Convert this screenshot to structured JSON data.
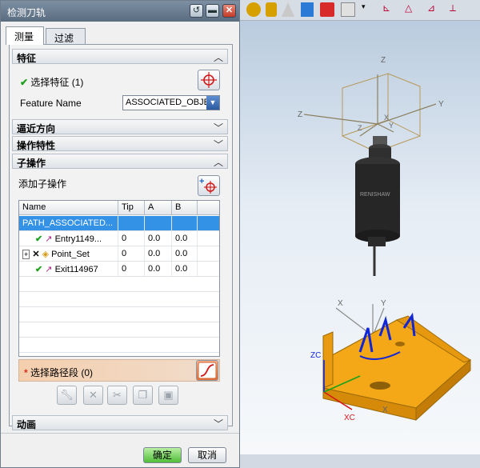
{
  "dialog": {
    "title": "检测刀轨",
    "tabs": [
      "测量",
      "过滤"
    ],
    "sections": {
      "feature": "特征",
      "approach": "逼近方向",
      "op_props": "操作特性",
      "sub_ops": "子操作",
      "animation": "动画"
    },
    "feature": {
      "select_label": "选择特征 (1)",
      "name_label": "Feature Name",
      "name_value": "ASSOCIATED_OBJE"
    },
    "sub_ops": {
      "add_label": "添加子操作",
      "columns": [
        "Name",
        "Tip",
        "A",
        "B"
      ],
      "rows": [
        {
          "name": "PATH_ASSOCIATED...",
          "tip": "",
          "a": "",
          "b": ""
        },
        {
          "name": "Entry1149...",
          "tip": "0",
          "a": "0.0",
          "b": "0.0"
        },
        {
          "name": "Point_Set",
          "tip": "0",
          "a": "0.0",
          "b": "0.0"
        },
        {
          "name": "Exit114967",
          "tip": "0",
          "a": "0.0",
          "b": "0.0"
        }
      ],
      "select_path_label": "选择路径段 (0)"
    },
    "buttons": {
      "ok": "确定",
      "cancel": "取消"
    }
  },
  "viewport": {
    "axis_labels": {
      "z": "Z",
      "y": "Y",
      "x": "X",
      "zc": "ZC",
      "xc": "XC"
    }
  },
  "colors": {
    "accent": "#3391e6",
    "check": "#1aa01a",
    "required": "#d9321f",
    "part": "#f4a818",
    "probe": "#262626"
  }
}
